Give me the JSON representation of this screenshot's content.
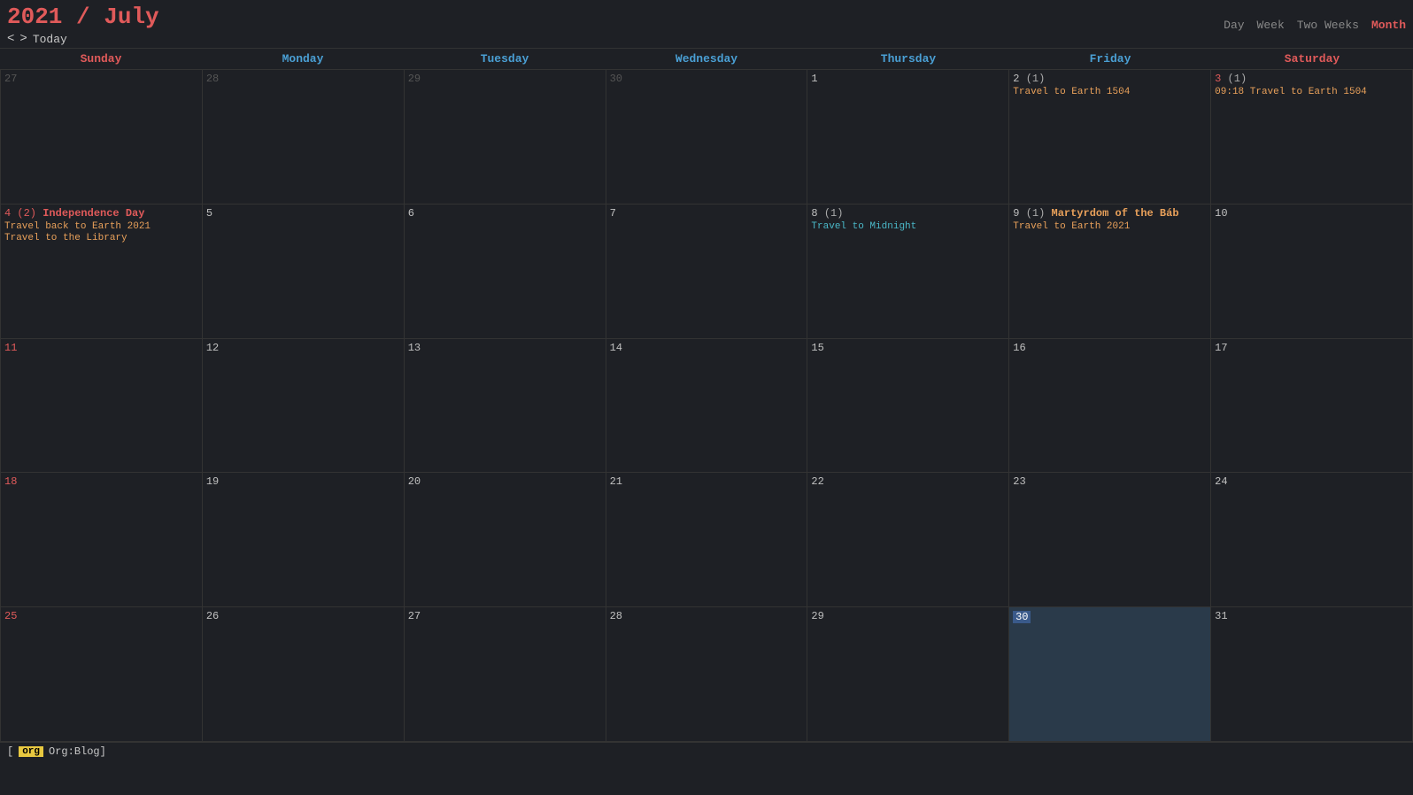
{
  "header": {
    "year": "2021",
    "separator": " / ",
    "month": "July",
    "nav": {
      "prev": "<",
      "next": ">",
      "today": "Today"
    },
    "views": [
      "Day",
      "Week",
      "Two Weeks",
      "Month"
    ],
    "active_view": "Month"
  },
  "days_of_week": [
    {
      "label": "Sunday",
      "type": "weekend"
    },
    {
      "label": "Monday",
      "type": "weekday"
    },
    {
      "label": "Tuesday",
      "type": "weekday"
    },
    {
      "label": "Wednesday",
      "type": "weekday"
    },
    {
      "label": "Thursday",
      "type": "weekday"
    },
    {
      "label": "Friday",
      "type": "weekday"
    },
    {
      "label": "Saturday",
      "type": "weekend"
    }
  ],
  "weeks": [
    {
      "days": [
        {
          "num": "27",
          "other_month": true,
          "events": []
        },
        {
          "num": "28",
          "other_month": true,
          "events": []
        },
        {
          "num": "29",
          "other_month": true,
          "events": []
        },
        {
          "num": "30",
          "other_month": true,
          "events": []
        },
        {
          "num": "1",
          "events": []
        },
        {
          "num": "2",
          "count": "(1)",
          "events": [
            {
              "text": "Travel to Earth 1504",
              "color": "orange"
            }
          ]
        },
        {
          "num": "3",
          "count": "(1)",
          "red_num": true,
          "events": [
            {
              "text": "09:18 Travel to Earth 1504",
              "color": "orange"
            }
          ]
        }
      ]
    },
    {
      "days": [
        {
          "num": "4",
          "count": "(2)",
          "red_num": true,
          "events": [
            {
              "text": "Independence Day",
              "color": "red",
              "bold": true
            },
            {
              "text": "Travel back to Earth 2021",
              "color": "orange"
            },
            {
              "text": "Travel to the Library",
              "color": "orange"
            }
          ]
        },
        {
          "num": "5",
          "events": []
        },
        {
          "num": "6",
          "events": []
        },
        {
          "num": "7",
          "events": []
        },
        {
          "num": "8",
          "count": "(1)",
          "events": [
            {
              "text": "Travel to Midnight",
              "color": "cyan"
            }
          ]
        },
        {
          "num": "9",
          "count": "(1)",
          "events": [
            {
              "text": "Martyrdom of the Báb",
              "color": "orange",
              "bold": true
            },
            {
              "text": "Travel to Earth 2021",
              "color": "orange"
            }
          ]
        },
        {
          "num": "10",
          "events": []
        }
      ]
    },
    {
      "days": [
        {
          "num": "11",
          "red_num": true,
          "events": []
        },
        {
          "num": "12",
          "events": []
        },
        {
          "num": "13",
          "events": []
        },
        {
          "num": "14",
          "events": []
        },
        {
          "num": "15",
          "events": []
        },
        {
          "num": "16",
          "events": []
        },
        {
          "num": "17",
          "events": []
        }
      ]
    },
    {
      "days": [
        {
          "num": "18",
          "red_num": true,
          "events": []
        },
        {
          "num": "19",
          "events": []
        },
        {
          "num": "20",
          "events": []
        },
        {
          "num": "21",
          "events": []
        },
        {
          "num": "22",
          "events": []
        },
        {
          "num": "23",
          "events": []
        },
        {
          "num": "24",
          "events": []
        }
      ]
    },
    {
      "days": [
        {
          "num": "25",
          "red_num": true,
          "events": []
        },
        {
          "num": "26",
          "events": []
        },
        {
          "num": "27",
          "events": []
        },
        {
          "num": "28",
          "events": []
        },
        {
          "num": "29",
          "events": []
        },
        {
          "num": "30",
          "today": true,
          "events": []
        },
        {
          "num": "31",
          "events": []
        }
      ]
    }
  ],
  "bottom_bar": {
    "tag_label": "org",
    "blog_label": "Org:Blog]"
  }
}
